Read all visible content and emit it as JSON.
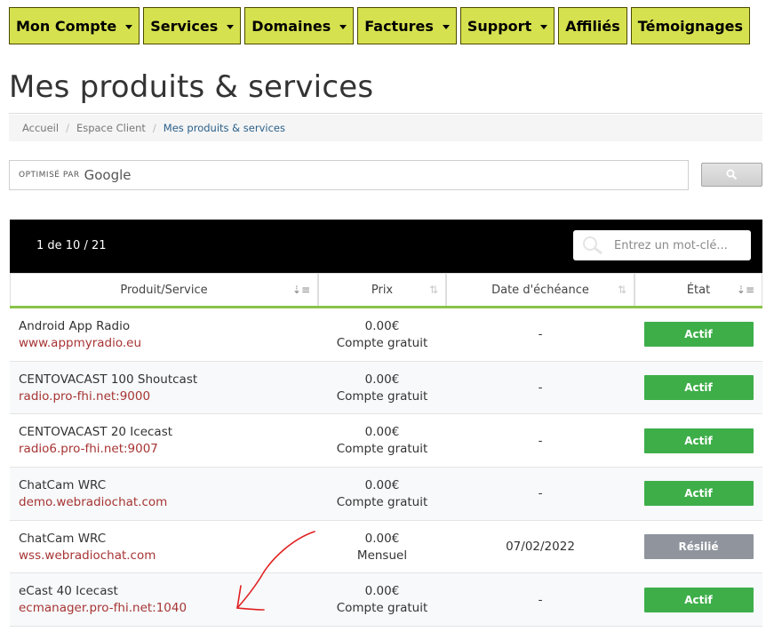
{
  "nav": [
    {
      "label": "Mon Compte",
      "dropdown": true
    },
    {
      "label": "Services",
      "dropdown": true
    },
    {
      "label": "Domaines",
      "dropdown": true
    },
    {
      "label": "Factures",
      "dropdown": true
    },
    {
      "label": "Support",
      "dropdown": true
    },
    {
      "label": "Affiliés",
      "dropdown": false
    },
    {
      "label": "Témoignages",
      "dropdown": false
    }
  ],
  "page_title": "Mes produits & services",
  "breadcrumb": [
    "Accueil",
    "Espace Client",
    "Mes produits & services"
  ],
  "search": {
    "powered_by": "OPTIMISÉ PAR",
    "brand": "Google",
    "button_icon": "search-icon"
  },
  "table": {
    "count": "1 de 10 / 21",
    "filter_placeholder": "Entrez un mot-clé...",
    "columns": [
      "Produit/Service",
      "Prix",
      "Date d'échéance",
      "État"
    ],
    "rows": [
      {
        "name": "Android App Radio",
        "domain": "www.appmyradio.eu",
        "price": "0.00€",
        "cycle": "Compte gratuit",
        "due": "-",
        "status": "Actif",
        "status_type": "active"
      },
      {
        "name": "CENTOVACAST 100 Shoutcast",
        "domain": "radio.pro-fhi.net:9000",
        "price": "0.00€",
        "cycle": "Compte gratuit",
        "due": "-",
        "status": "Actif",
        "status_type": "active"
      },
      {
        "name": "CENTOVACAST 20 Icecast",
        "domain": "radio6.pro-fhi.net:9007",
        "price": "0.00€",
        "cycle": "Compte gratuit",
        "due": "-",
        "status": "Actif",
        "status_type": "active"
      },
      {
        "name": "ChatCam WRC",
        "domain": "demo.webradiochat.com",
        "price": "0.00€",
        "cycle": "Compte gratuit",
        "due": "-",
        "status": "Actif",
        "status_type": "active"
      },
      {
        "name": "ChatCam WRC",
        "domain": "wss.webradiochat.com",
        "price": "0.00€",
        "cycle": "Mensuel",
        "due": "07/02/2022",
        "status": "Résilié",
        "status_type": "cancelled"
      },
      {
        "name": "eCast 40 Icecast",
        "domain": "ecmanager.pro-fhi.net:1040",
        "price": "0.00€",
        "cycle": "Compte gratuit",
        "due": "-",
        "status": "Actif",
        "status_type": "active"
      }
    ]
  },
  "colors": {
    "nav_bg": "#d6e14f",
    "active": "#3eae49",
    "cancelled": "#8f949d",
    "link": "#a73434",
    "accent": "#8ac349",
    "annotation": "#e02020"
  }
}
